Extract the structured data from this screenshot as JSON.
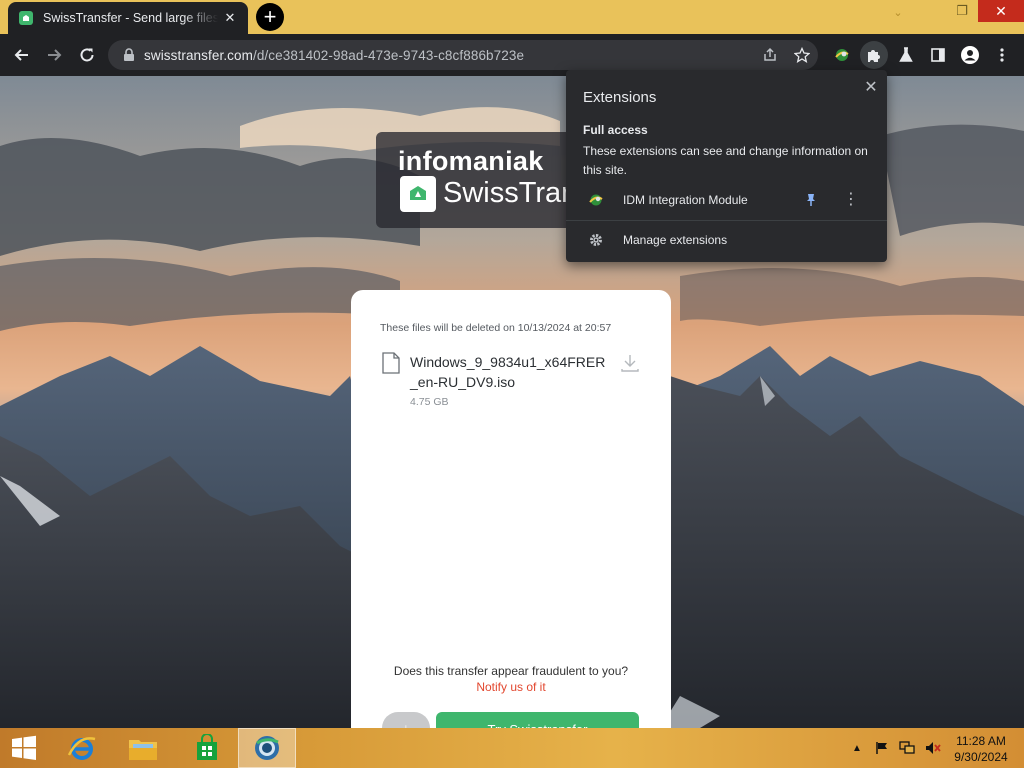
{
  "browser": {
    "tab": {
      "title": "SwissTransfer - Send large files s",
      "close": "✕"
    },
    "new_tab": "+",
    "url": {
      "host": "swisstransfer.com",
      "path": "/d/ce381402-98ad-473e-9743-c8cf886b723e"
    },
    "window": {
      "dropdown": "⌄",
      "minimize": "—",
      "maximize": "❐",
      "close": "✕"
    },
    "toolbar_icons": [
      "back-icon",
      "forward-icon",
      "reload-icon",
      "lock-icon",
      "share-icon",
      "bookmark-star-icon",
      "idm-extension-icon",
      "extensions-puzzle-icon",
      "lab-flask-icon",
      "side-panel-icon",
      "profile-icon",
      "menu-dots-icon"
    ]
  },
  "extensions_popup": {
    "title": "Extensions",
    "close": "✕",
    "full_access_label": "Full access",
    "full_access_desc": "These extensions can see and change information on this site.",
    "items": [
      {
        "name": "IDM Integration Module",
        "pinned": true,
        "more": "⋮"
      }
    ],
    "manage_label": "Manage extensions"
  },
  "page": {
    "brand_top": "infomaniak",
    "brand_name": "SwissTransfer",
    "card": {
      "expiry": "These files will be deleted on 10/13/2024 at 20:57",
      "file_name": "Windows_9_9834u1_x64FRER_en-RU_DV9.iso",
      "file_size": "4.75 GB",
      "fraud_text": "Does this transfer appear fraudulent to you?",
      "fraud_link": "Notify us of it",
      "download_button": "↓",
      "try_button": "Try Swisstransfer"
    },
    "colors": {
      "accent_green": "#3fb66d",
      "link_red": "#e2472f"
    }
  },
  "taskbar": {
    "items": [
      "start-button",
      "internet-explorer-icon",
      "file-explorer-icon",
      "store-icon",
      "chrome-like-browser-icon"
    ],
    "tray": [
      "show-hidden-icons-icon",
      "flag-icon",
      "network-icon",
      "volume-muted-icon"
    ],
    "clock": {
      "time": "11:28 AM",
      "date": "9/30/2024"
    }
  }
}
